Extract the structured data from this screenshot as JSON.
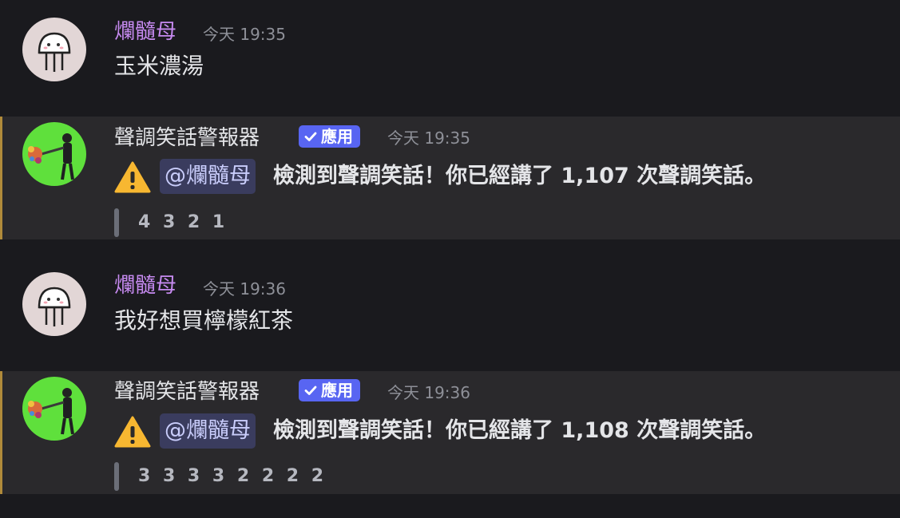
{
  "messages": [
    {
      "author": "爛髓母",
      "timestamp": "今天 19:35",
      "content": "玉米濃湯"
    },
    {
      "author": "聲調笑話警報器",
      "badge": "應用",
      "timestamp": "今天 19:35",
      "mention": "@爛髓母",
      "alert": "檢測到聲調笑話！你已經講了 1,107 次聲調笑話。",
      "quote": "4 3 2 1"
    },
    {
      "author": "爛髓母",
      "timestamp": "今天 19:36",
      "content": "我好想買檸檬紅茶"
    },
    {
      "author": "聲調笑話警報器",
      "badge": "應用",
      "timestamp": "今天 19:36",
      "mention": "@爛髓母",
      "alert": "檢測到聲調笑話！你已經講了 1,108 次聲調笑話。",
      "quote": "3 3 3 3 2 2 2 2"
    }
  ],
  "icons": {
    "user_avatar": "jellyfish-avatar-icon",
    "bot_avatar": "bot-avatar-icon",
    "warning": "warning-icon",
    "badge_check": "check-icon"
  },
  "colors": {
    "user_name": "#c68af0",
    "badge": "#5865f2",
    "bot_highlight_border": "#b08a3a",
    "mention_bg": "#3a3c5e"
  }
}
